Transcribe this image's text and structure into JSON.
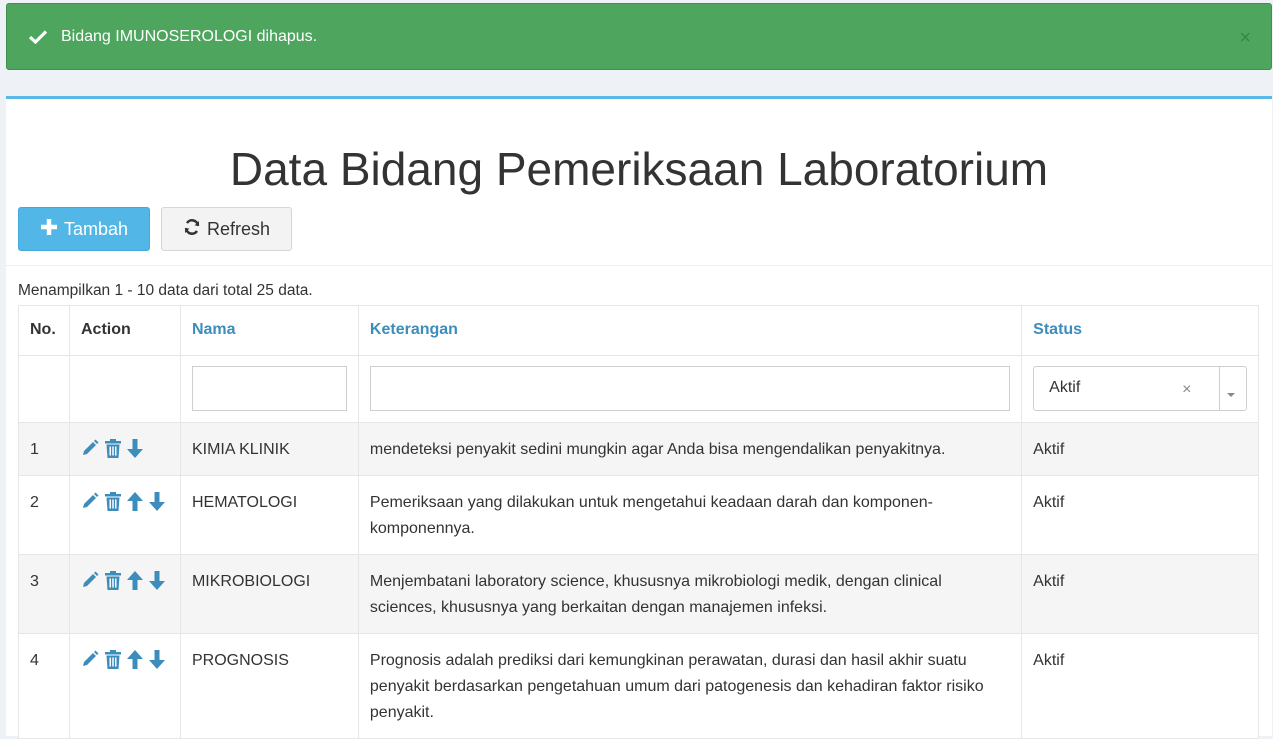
{
  "alert": {
    "message": "Bidang IMUNOSEROLOGI dihapus.",
    "close": "×",
    "color": "#4ea65e"
  },
  "page": {
    "title": "Data Bidang Pemeriksaan Laboratorium",
    "add_label": "Tambah",
    "refresh_label": "Refresh",
    "summary": "Menampilkan 1 - 10 data dari total 25 data."
  },
  "table": {
    "headers": {
      "no": "No.",
      "action": "Action",
      "nama": "Nama",
      "keterangan": "Keterangan",
      "status": "Status"
    },
    "filter": {
      "nama": "",
      "keterangan": "",
      "status": "Aktif",
      "clear": "×"
    },
    "rows": [
      {
        "no": "1",
        "nama": "KIMIA KLINIK",
        "keterangan": "mendeteksi penyakit sedini mungkin agar Anda bisa mengendalikan penyakitnya.",
        "status": "Aktif"
      },
      {
        "no": "2",
        "nama": "HEMATOLOGI",
        "keterangan": "Pemeriksaan yang dilakukan untuk mengetahui keadaan darah dan komponen-komponennya.",
        "status": "Aktif"
      },
      {
        "no": "3",
        "nama": "MIKROBIOLOGI",
        "keterangan": "Menjembatani laboratory science, khususnya mikrobiologi medik, dengan clinical sciences, khususnya yang berkaitan dengan manajemen infeksi.",
        "status": "Aktif"
      },
      {
        "no": "4",
        "nama": "PROGNOSIS",
        "keterangan": "Prognosis adalah prediksi dari kemungkinan perawatan, durasi dan hasil akhir suatu penyakit berdasarkan pengetahuan umum dari patogenesis dan kehadiran faktor risiko penyakit.",
        "status": "Aktif"
      }
    ]
  },
  "icons": {
    "check": "check-icon",
    "add": "plus-icon",
    "refresh": "refresh-icon",
    "edit": "pencil-icon",
    "delete": "trash-icon",
    "up": "arrow-up-icon",
    "down": "arrow-down-icon"
  },
  "colors": {
    "accent": "#52b7e6",
    "link": "#3c8dbc",
    "icon": "#3c8dbc"
  }
}
